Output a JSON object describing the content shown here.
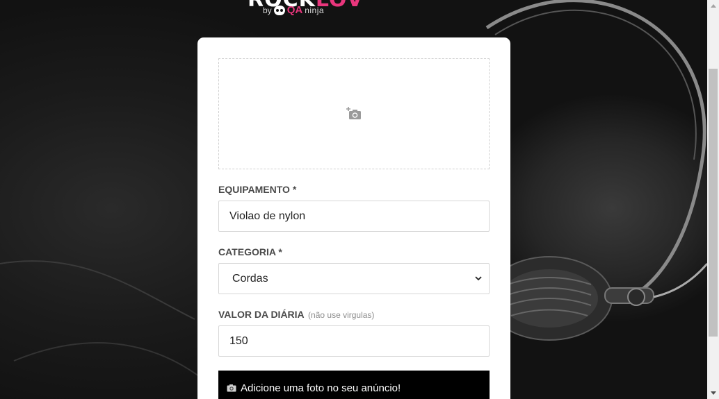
{
  "logo": {
    "title_main": "ROCK",
    "title_accent": "LOV",
    "by_label": "by",
    "brand_qa": "QA",
    "brand_ninja": "ninja"
  },
  "form": {
    "equipment_label": "EQUIPAMENTO *",
    "equipment_value": "Violao de nylon",
    "category_label": "CATEGORIA *",
    "category_value": "Cordas",
    "price_label": "VALOR DA DIÁRIA",
    "price_hint": "(não use virgulas)",
    "price_value": "150",
    "submit_label": "Adicione uma foto no seu anúncio!"
  },
  "colors": {
    "accent": "#e8367c",
    "card": "#ffffff",
    "button": "#000000"
  },
  "icons": {
    "thumbnail": "add-photo-icon",
    "button": "camera-icon",
    "select": "chevron-down-icon"
  }
}
